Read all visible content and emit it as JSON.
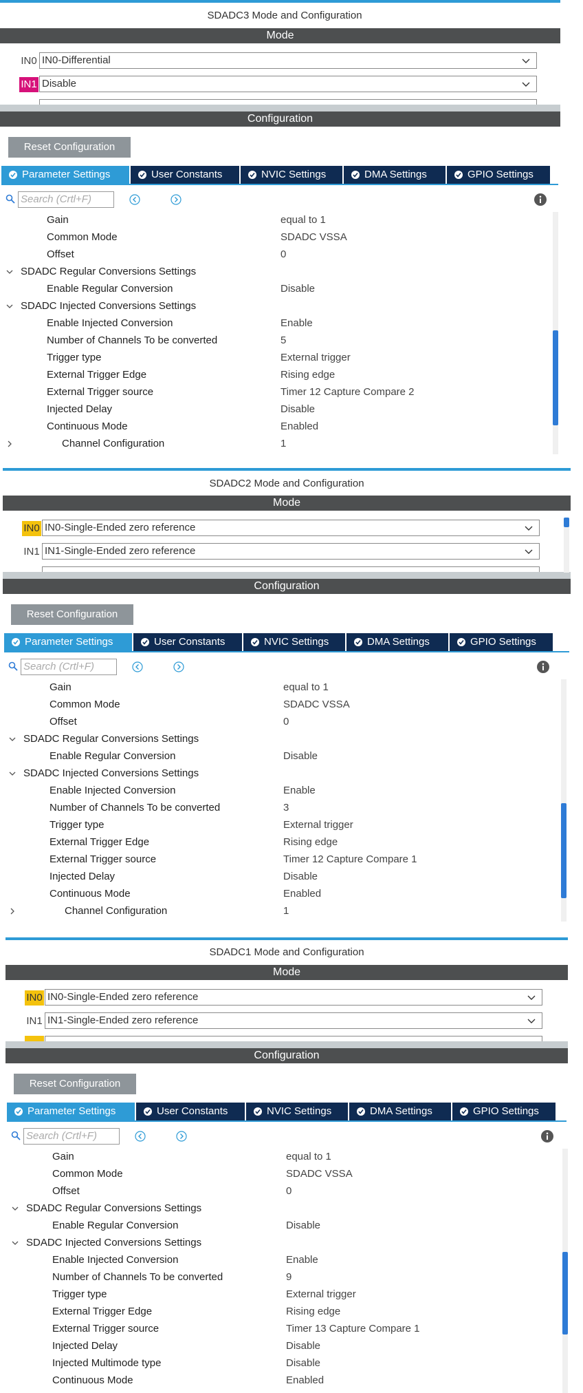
{
  "common": {
    "reset_label": "Reset Configuration",
    "mode_label": "Mode",
    "config_label": "Configuration",
    "search_placeholder": "Search (Crtl+F)",
    "tabs": [
      "Parameter Settings",
      "User Constants",
      "NVIC Settings",
      "DMA Settings",
      "GPIO Settings"
    ],
    "labels": {
      "gain": "Gain",
      "common_mode": "Common Mode",
      "offset": "Offset",
      "regular_group": "SDADC Regular Conversions Settings",
      "enable_regular": "Enable Regular Conversion",
      "injected_group": "SDADC Injected Conversions Settings",
      "enable_injected": "Enable Injected Conversion",
      "num_channels": "Number of Channels To be converted",
      "trigger_type": "Trigger type",
      "trigger_edge": "External Trigger Edge",
      "trigger_source": "External Trigger source",
      "injected_delay": "Injected Delay",
      "injected_multimode": "Injected Multimode type",
      "continuous_mode": "Continuous Mode",
      "channel_config": "Channel Configuration"
    }
  },
  "panels": [
    {
      "title": "SDADC3 Mode and Configuration",
      "in0_label": "IN0",
      "in0_value": "IN0-Differential",
      "in1_label": "IN1",
      "in1_value": "Disable",
      "params": {
        "gain": "equal to 1",
        "common_mode": "SDADC VSSA",
        "offset": "0",
        "enable_regular": "Disable",
        "enable_injected": "Enable",
        "num_channels": "5",
        "trigger_type": "External trigger",
        "trigger_edge": "Rising edge",
        "trigger_source": "Timer 12 Capture Compare 2",
        "injected_delay": "Disable",
        "continuous_mode": "Enabled",
        "channel_config": "1"
      }
    },
    {
      "title": "SDADC2 Mode and Configuration",
      "in0_label": "IN0",
      "in0_value": "IN0-Single-Ended zero reference",
      "in1_label": "IN1",
      "in1_value": "IN1-Single-Ended zero reference",
      "params": {
        "gain": "equal to 1",
        "common_mode": "SDADC VSSA",
        "offset": "0",
        "enable_regular": "Disable",
        "enable_injected": "Enable",
        "num_channels": "3",
        "trigger_type": "External trigger",
        "trigger_edge": "Rising edge",
        "trigger_source": "Timer 12 Capture Compare 1",
        "injected_delay": "Disable",
        "continuous_mode": "Enabled",
        "channel_config": "1"
      }
    },
    {
      "title": "SDADC1 Mode and Configuration",
      "in0_label": "IN0",
      "in0_value": "IN0-Single-Ended zero reference",
      "in1_label": "IN1",
      "in1_value": "IN1-Single-Ended zero reference",
      "params": {
        "gain": "equal to 1",
        "common_mode": "SDADC VSSA",
        "offset": "0",
        "enable_regular": "Disable",
        "enable_injected": "Enable",
        "num_channels": "9",
        "trigger_type": "External trigger",
        "trigger_edge": "Rising edge",
        "trigger_source": "Timer 13 Capture Compare 1",
        "injected_delay": "Disable",
        "injected_multimode": "Disable",
        "continuous_mode": "Enabled"
      }
    }
  ]
}
